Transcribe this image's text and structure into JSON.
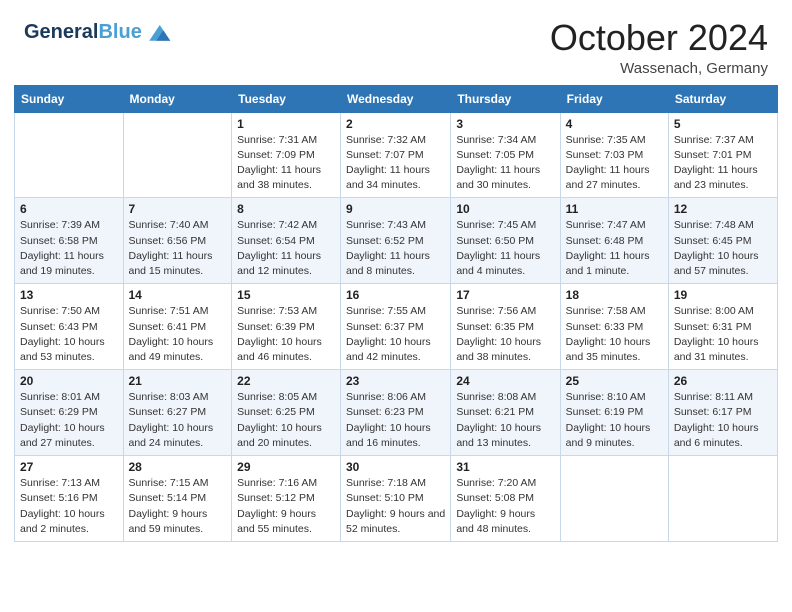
{
  "header": {
    "logo_line1": "General",
    "logo_line2": "Blue",
    "month": "October 2024",
    "location": "Wassenach, Germany"
  },
  "weekdays": [
    "Sunday",
    "Monday",
    "Tuesday",
    "Wednesday",
    "Thursday",
    "Friday",
    "Saturday"
  ],
  "weeks": [
    [
      null,
      null,
      {
        "day": 1,
        "sunrise": "Sunrise: 7:31 AM",
        "sunset": "Sunset: 7:09 PM",
        "daylight": "Daylight: 11 hours and 38 minutes."
      },
      {
        "day": 2,
        "sunrise": "Sunrise: 7:32 AM",
        "sunset": "Sunset: 7:07 PM",
        "daylight": "Daylight: 11 hours and 34 minutes."
      },
      {
        "day": 3,
        "sunrise": "Sunrise: 7:34 AM",
        "sunset": "Sunset: 7:05 PM",
        "daylight": "Daylight: 11 hours and 30 minutes."
      },
      {
        "day": 4,
        "sunrise": "Sunrise: 7:35 AM",
        "sunset": "Sunset: 7:03 PM",
        "daylight": "Daylight: 11 hours and 27 minutes."
      },
      {
        "day": 5,
        "sunrise": "Sunrise: 7:37 AM",
        "sunset": "Sunset: 7:01 PM",
        "daylight": "Daylight: 11 hours and 23 minutes."
      }
    ],
    [
      {
        "day": 6,
        "sunrise": "Sunrise: 7:39 AM",
        "sunset": "Sunset: 6:58 PM",
        "daylight": "Daylight: 11 hours and 19 minutes."
      },
      {
        "day": 7,
        "sunrise": "Sunrise: 7:40 AM",
        "sunset": "Sunset: 6:56 PM",
        "daylight": "Daylight: 11 hours and 15 minutes."
      },
      {
        "day": 8,
        "sunrise": "Sunrise: 7:42 AM",
        "sunset": "Sunset: 6:54 PM",
        "daylight": "Daylight: 11 hours and 12 minutes."
      },
      {
        "day": 9,
        "sunrise": "Sunrise: 7:43 AM",
        "sunset": "Sunset: 6:52 PM",
        "daylight": "Daylight: 11 hours and 8 minutes."
      },
      {
        "day": 10,
        "sunrise": "Sunrise: 7:45 AM",
        "sunset": "Sunset: 6:50 PM",
        "daylight": "Daylight: 11 hours and 4 minutes."
      },
      {
        "day": 11,
        "sunrise": "Sunrise: 7:47 AM",
        "sunset": "Sunset: 6:48 PM",
        "daylight": "Daylight: 11 hours and 1 minute."
      },
      {
        "day": 12,
        "sunrise": "Sunrise: 7:48 AM",
        "sunset": "Sunset: 6:45 PM",
        "daylight": "Daylight: 10 hours and 57 minutes."
      }
    ],
    [
      {
        "day": 13,
        "sunrise": "Sunrise: 7:50 AM",
        "sunset": "Sunset: 6:43 PM",
        "daylight": "Daylight: 10 hours and 53 minutes."
      },
      {
        "day": 14,
        "sunrise": "Sunrise: 7:51 AM",
        "sunset": "Sunset: 6:41 PM",
        "daylight": "Daylight: 10 hours and 49 minutes."
      },
      {
        "day": 15,
        "sunrise": "Sunrise: 7:53 AM",
        "sunset": "Sunset: 6:39 PM",
        "daylight": "Daylight: 10 hours and 46 minutes."
      },
      {
        "day": 16,
        "sunrise": "Sunrise: 7:55 AM",
        "sunset": "Sunset: 6:37 PM",
        "daylight": "Daylight: 10 hours and 42 minutes."
      },
      {
        "day": 17,
        "sunrise": "Sunrise: 7:56 AM",
        "sunset": "Sunset: 6:35 PM",
        "daylight": "Daylight: 10 hours and 38 minutes."
      },
      {
        "day": 18,
        "sunrise": "Sunrise: 7:58 AM",
        "sunset": "Sunset: 6:33 PM",
        "daylight": "Daylight: 10 hours and 35 minutes."
      },
      {
        "day": 19,
        "sunrise": "Sunrise: 8:00 AM",
        "sunset": "Sunset: 6:31 PM",
        "daylight": "Daylight: 10 hours and 31 minutes."
      }
    ],
    [
      {
        "day": 20,
        "sunrise": "Sunrise: 8:01 AM",
        "sunset": "Sunset: 6:29 PM",
        "daylight": "Daylight: 10 hours and 27 minutes."
      },
      {
        "day": 21,
        "sunrise": "Sunrise: 8:03 AM",
        "sunset": "Sunset: 6:27 PM",
        "daylight": "Daylight: 10 hours and 24 minutes."
      },
      {
        "day": 22,
        "sunrise": "Sunrise: 8:05 AM",
        "sunset": "Sunset: 6:25 PM",
        "daylight": "Daylight: 10 hours and 20 minutes."
      },
      {
        "day": 23,
        "sunrise": "Sunrise: 8:06 AM",
        "sunset": "Sunset: 6:23 PM",
        "daylight": "Daylight: 10 hours and 16 minutes."
      },
      {
        "day": 24,
        "sunrise": "Sunrise: 8:08 AM",
        "sunset": "Sunset: 6:21 PM",
        "daylight": "Daylight: 10 hours and 13 minutes."
      },
      {
        "day": 25,
        "sunrise": "Sunrise: 8:10 AM",
        "sunset": "Sunset: 6:19 PM",
        "daylight": "Daylight: 10 hours and 9 minutes."
      },
      {
        "day": 26,
        "sunrise": "Sunrise: 8:11 AM",
        "sunset": "Sunset: 6:17 PM",
        "daylight": "Daylight: 10 hours and 6 minutes."
      }
    ],
    [
      {
        "day": 27,
        "sunrise": "Sunrise: 7:13 AM",
        "sunset": "Sunset: 5:16 PM",
        "daylight": "Daylight: 10 hours and 2 minutes."
      },
      {
        "day": 28,
        "sunrise": "Sunrise: 7:15 AM",
        "sunset": "Sunset: 5:14 PM",
        "daylight": "Daylight: 9 hours and 59 minutes."
      },
      {
        "day": 29,
        "sunrise": "Sunrise: 7:16 AM",
        "sunset": "Sunset: 5:12 PM",
        "daylight": "Daylight: 9 hours and 55 minutes."
      },
      {
        "day": 30,
        "sunrise": "Sunrise: 7:18 AM",
        "sunset": "Sunset: 5:10 PM",
        "daylight": "Daylight: 9 hours and 52 minutes."
      },
      {
        "day": 31,
        "sunrise": "Sunrise: 7:20 AM",
        "sunset": "Sunset: 5:08 PM",
        "daylight": "Daylight: 9 hours and 48 minutes."
      },
      null,
      null
    ]
  ]
}
